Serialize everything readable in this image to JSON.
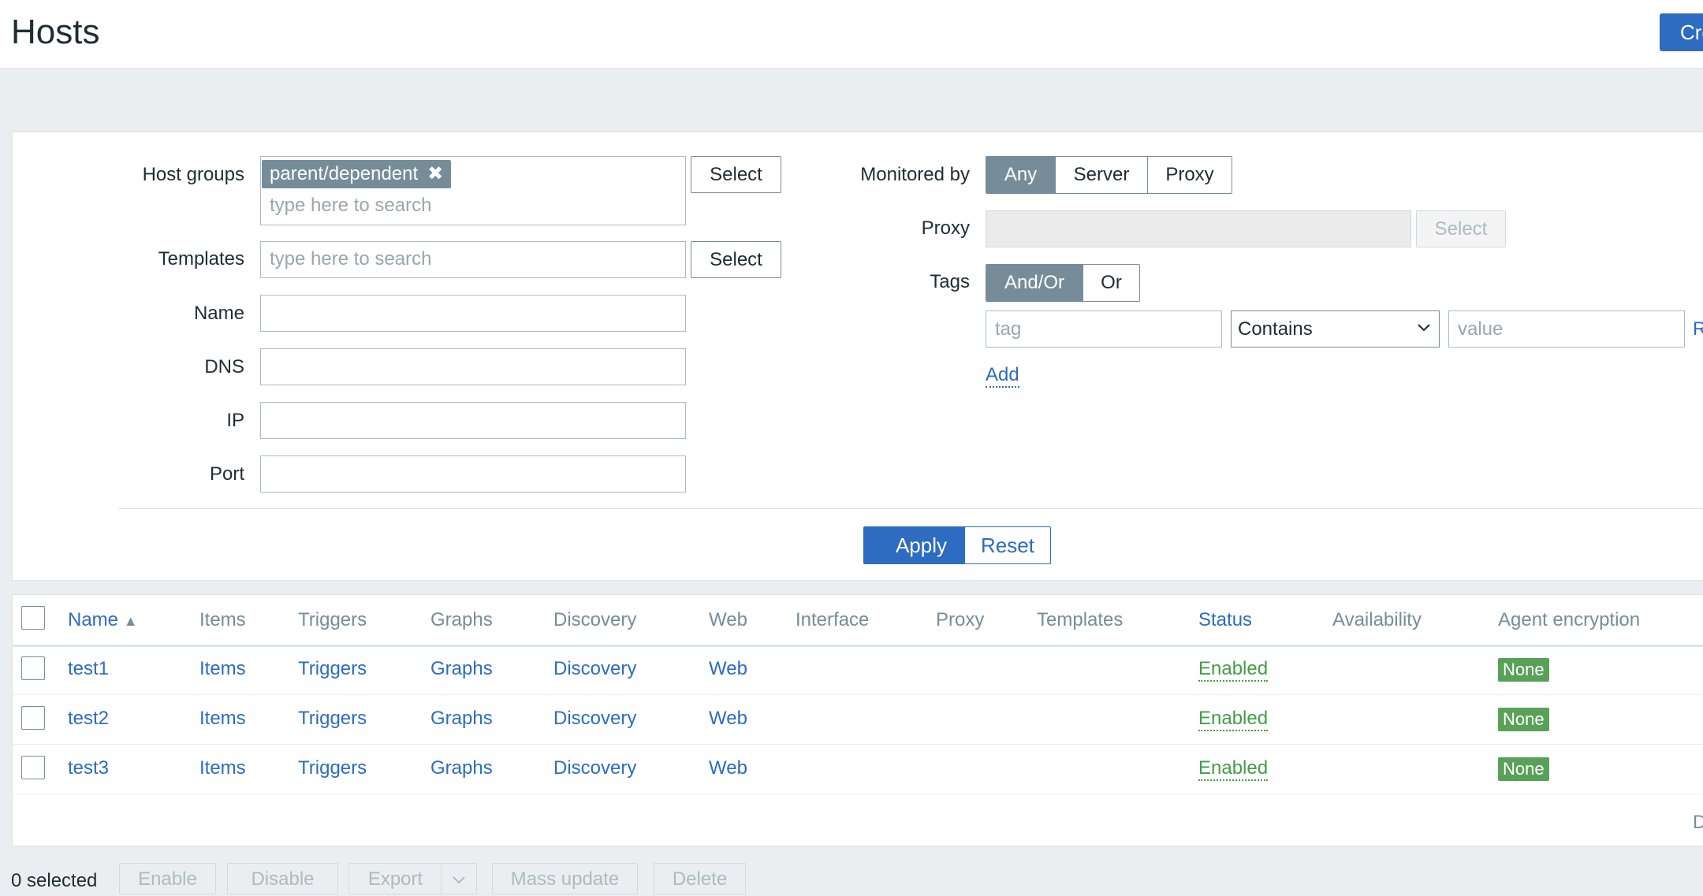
{
  "header": {
    "title": "Hosts",
    "create_label": "Cre"
  },
  "filter": {
    "host_groups": {
      "label": "Host groups",
      "chip": "parent/dependent",
      "chip_remove": "✖",
      "placeholder": "type here to search",
      "select_label": "Select"
    },
    "templates": {
      "label": "Templates",
      "placeholder": "type here to search",
      "select_label": "Select"
    },
    "name": {
      "label": "Name",
      "value": ""
    },
    "dns": {
      "label": "DNS",
      "value": ""
    },
    "ip": {
      "label": "IP",
      "value": ""
    },
    "port": {
      "label": "Port",
      "value": ""
    },
    "monitored_by": {
      "label": "Monitored by",
      "options": [
        "Any",
        "Server",
        "Proxy"
      ],
      "selected": "Any"
    },
    "proxy": {
      "label": "Proxy",
      "select_label": "Select"
    },
    "tags": {
      "label": "Tags",
      "options": [
        "And/Or",
        "Or"
      ],
      "selected": "And/Or",
      "tag_placeholder": "tag",
      "operator": "Contains",
      "value_placeholder": "value",
      "remove_label": "R",
      "add_label": "Add"
    },
    "apply_label": "Apply",
    "reset_label": "Reset"
  },
  "table": {
    "columns": [
      "Name",
      "Items",
      "Triggers",
      "Graphs",
      "Discovery",
      "Web",
      "Interface",
      "Proxy",
      "Templates",
      "Status",
      "Availability",
      "Agent encryption"
    ],
    "sort_indicator": "▲",
    "rows": [
      {
        "name": "test1",
        "items": "Items",
        "triggers": "Triggers",
        "graphs": "Graphs",
        "discovery": "Discovery",
        "web": "Web",
        "status": "Enabled",
        "encryption": "None"
      },
      {
        "name": "test2",
        "items": "Items",
        "triggers": "Triggers",
        "graphs": "Graphs",
        "discovery": "Discovery",
        "web": "Web",
        "status": "Enabled",
        "encryption": "None"
      },
      {
        "name": "test3",
        "items": "Items",
        "triggers": "Triggers",
        "graphs": "Graphs",
        "discovery": "Discovery",
        "web": "Web",
        "status": "Enabled",
        "encryption": "None"
      }
    ],
    "footer_cut": "D"
  },
  "footer": {
    "selected_count": "0 selected",
    "buttons": [
      "Enable",
      "Disable",
      "Export",
      "Mass update",
      "Delete"
    ],
    "export_dropdown_icon": "chevron-down-icon"
  },
  "colors": {
    "accent": "#2d6cc0",
    "enabled": "#429e47",
    "badge": "#59a159",
    "segment_active": "#768d99"
  }
}
